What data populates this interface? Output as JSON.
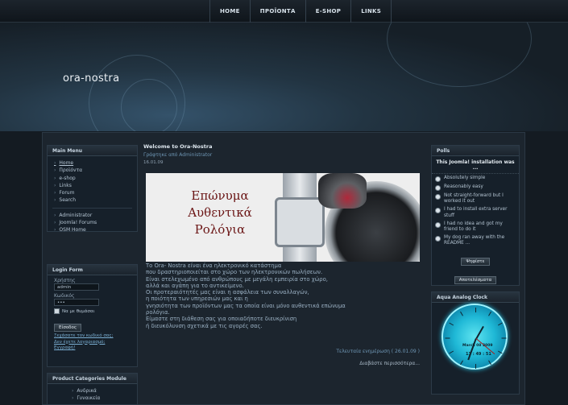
{
  "nav": {
    "items": [
      "HOME",
      "ΠΡΟΪΟΝΤΑ",
      "E-SHOP",
      "LINKS"
    ]
  },
  "header": {
    "site_title": "ora-nostra"
  },
  "main_menu": {
    "title": "Main Menu",
    "items": [
      "Home",
      "Προϊόντα",
      "e-shop",
      "Links",
      "Forum",
      "Search"
    ],
    "items2": [
      "Administrator",
      "Joomla! Forums",
      "OSM Home"
    ]
  },
  "login_form": {
    "title": "Login Form",
    "username_label": "Χρήστης",
    "username_value": "admin",
    "password_label": "Κωδικός",
    "password_value": "•••",
    "remember_label": "Να με θυμάσαι",
    "login_button": "Είσοδος",
    "forgot_password": "Ξεχάσατε τον κωδικό σας;",
    "forgot_username": "Δεν έχετε λογαριασμό;",
    "register": "Εγγραφή!"
  },
  "product_categories": {
    "title": "Product Categories Module",
    "items": [
      "Ανδρικά",
      "Γυναικεία"
    ]
  },
  "article": {
    "title": "Welcome to Ora-Nostra",
    "author": "Γράφτηκε από Administrator",
    "date": "16.01.09",
    "banner_text": [
      "Επώνυμα",
      "Αυθεντικά",
      "Ρολόγια"
    ],
    "body": "Το Ora- Nostra είναι ένα ηλεκτρονικό κατάστημα\nπου δραστηριοποιείται στο χώρο των ηλεκτρονικών πωλήσεων.\nΕίναι στελεχωμένο από ανθρώπους με μεγάλη εμπειρία στο χώρο,\nαλλά και αγάπη για το αντικείμενο.\nΟι προτεραιότητές μας είναι η ασφάλεια των συναλλαγών,\nη ποιότητα των υπηρεσιών μας και η\nγνησιότητα των προϊόντων μας τα οποία είναι μόνο αυθεντικά επώνυμα\nρολόγια.\nΕίμαστε στη διάθεση σας για οποιαδήποτε διευκρίνιση\nή διευκόλυνση σχετικά με τις αγορές σας.",
    "last_updated": "Τελευταία ενημέρωση ( 26.01.09 )",
    "read_more": "Διαβάστε περισσότερα..."
  },
  "polls": {
    "title": "Polls",
    "question": "This Joomla! installation was ...",
    "options": [
      "Absolutely simple",
      "Reasonably easy",
      "Not straight-forward but I worked it out",
      "I had to install extra server stuff",
      "I had no idea and got my friend to do it",
      "My dog ran away with the README ..."
    ],
    "vote_button": "Ψηφίστε",
    "results_button": "Αποτελέσματα"
  },
  "clock": {
    "title": "Aqua Analog Clock",
    "date": "March 08 2009",
    "time": "13 : 49 : 51",
    "accent_color": "#28c4e6"
  }
}
